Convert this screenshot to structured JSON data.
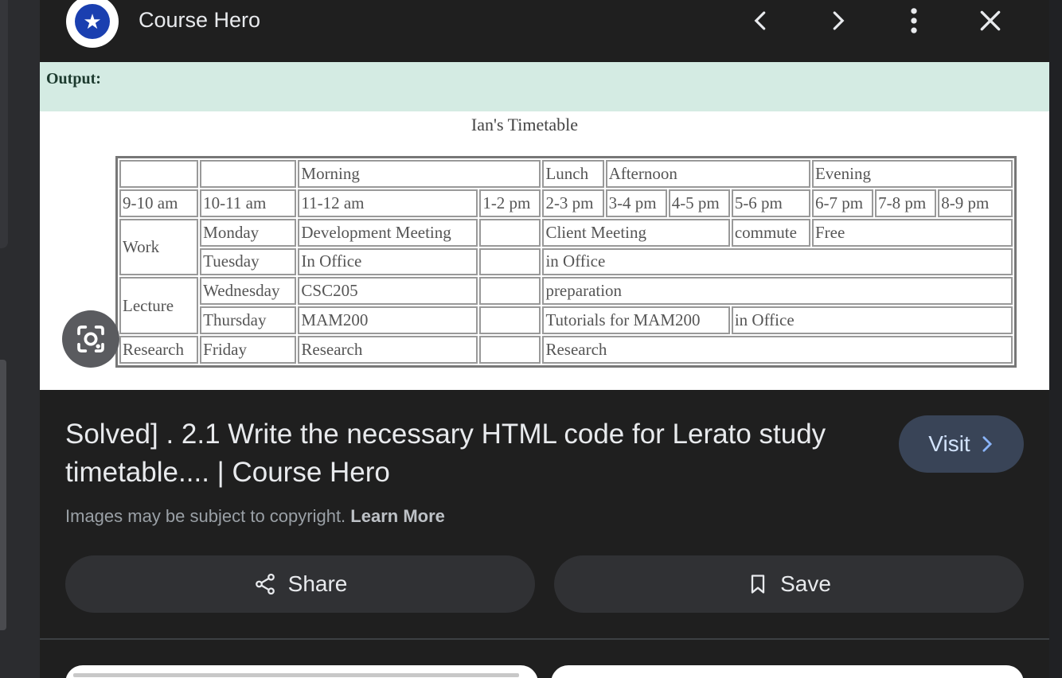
{
  "header": {
    "site_name": "Course Hero",
    "icons": [
      "course-hero-logo",
      "chevron-left-icon",
      "chevron-right-icon",
      "more-vert-icon",
      "close-icon"
    ]
  },
  "preview": {
    "output_label": "Output:",
    "table_title": "Ian's Timetable",
    "rows": [
      [
        {
          "t": ""
        },
        {
          "t": ""
        },
        {
          "t": "Morning",
          "cs": 2
        },
        {
          "t": "Lunch"
        },
        {
          "t": "Afternoon",
          "cs": 3
        },
        {
          "t": "Evening",
          "cs": 3
        }
      ],
      [
        {
          "t": "9-10 am"
        },
        {
          "t": "10-11 am"
        },
        {
          "t": "11-12 am"
        },
        {
          "t": "1-2 pm"
        },
        {
          "t": "2-3 pm"
        },
        {
          "t": "3-4 pm"
        },
        {
          "t": "4-5 pm"
        },
        {
          "t": "5-6 pm"
        },
        {
          "t": "6-7 pm"
        },
        {
          "t": "7-8 pm"
        },
        {
          "t": "8-9 pm"
        }
      ],
      [
        {
          "t": "Work",
          "rs": 2
        },
        {
          "t": "Monday"
        },
        {
          "t": "Development Meeting"
        },
        {
          "t": ""
        },
        {
          "t": "Client Meeting",
          "cs": 3
        },
        {
          "t": "commute"
        },
        {
          "t": "Free",
          "cs": 3
        }
      ],
      [
        {
          "t": "Tuesday"
        },
        {
          "t": "In Office"
        },
        {
          "t": ""
        },
        {
          "t": "in Office",
          "cs": 7
        }
      ],
      [
        {
          "t": "Lecture",
          "rs": 2
        },
        {
          "t": "Wednesday"
        },
        {
          "t": "CSC205"
        },
        {
          "t": ""
        },
        {
          "t": "preparation",
          "cs": 7
        }
      ],
      [
        {
          "t": "Thursday"
        },
        {
          "t": "MAM200"
        },
        {
          "t": ""
        },
        {
          "t": "Tutorials for MAM200",
          "cs": 3
        },
        {
          "t": "in Office",
          "cs": 4
        }
      ],
      [
        {
          "t": "Research"
        },
        {
          "t": "Friday"
        },
        {
          "t": "Research"
        },
        {
          "t": ""
        },
        {
          "t": "Research",
          "cs": 7
        }
      ]
    ]
  },
  "result": {
    "title": "Solved] . 2.1 Write the necessary HTML code for Lerato study timetable.... | Course Hero",
    "visit_label": "Visit",
    "copyright_text": "Images may be subject to copyright.",
    "learn_more": "Learn More"
  },
  "actions": {
    "share_label": "Share",
    "save_label": "Save"
  },
  "colors": {
    "panel_bg": "#1f1f1f",
    "visit_bg": "#394457",
    "button_bg": "#303134",
    "output_band": "#d4ebe3"
  }
}
